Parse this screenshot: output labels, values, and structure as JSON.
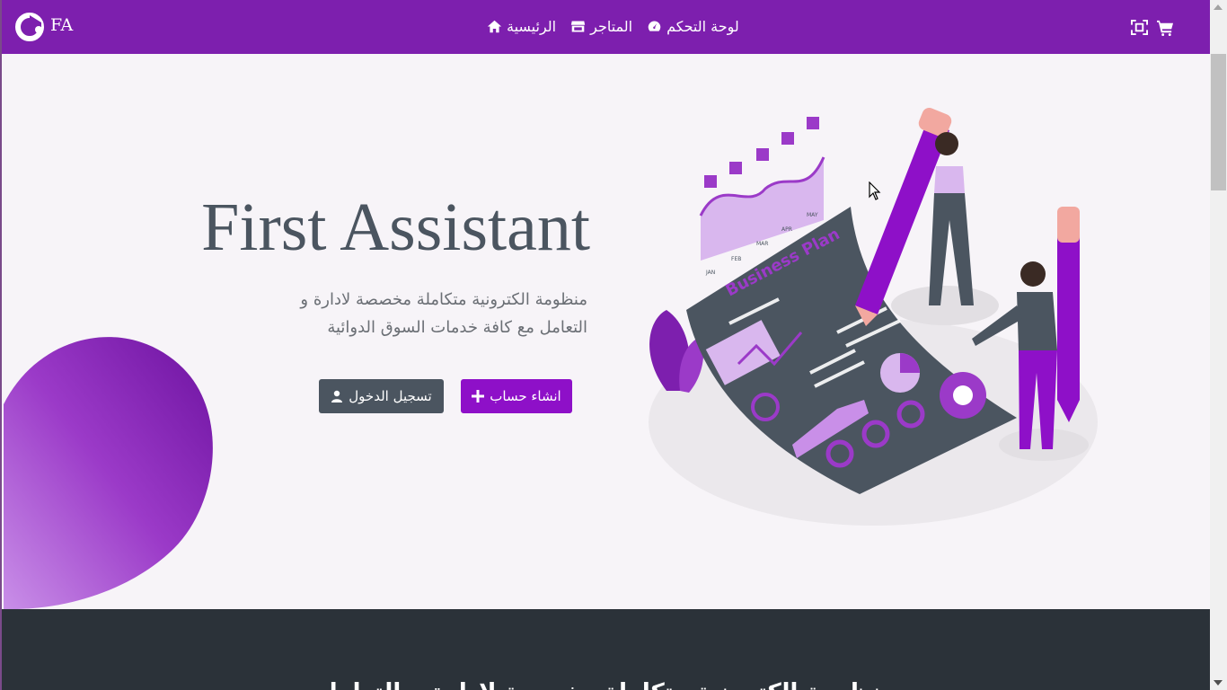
{
  "brand": {
    "logo": "fa-logo-icon",
    "name": "FA"
  },
  "nav": {
    "dashboard": "لوحة التحكم",
    "stores": "المتاجر",
    "home": "الرئيسية"
  },
  "icons": {
    "dashboard": "tachometer-icon",
    "stores": "store-icon",
    "home": "home-icon",
    "cart": "shopping-cart-icon",
    "qr": "qr-scan-icon"
  },
  "hero": {
    "title": "First Assistant",
    "description": "منظومة الكترونية متكاملة مخصصة لادارة و التعامل مع كافة خدمات السوق الدوائية",
    "illustration_label": "Business Plan",
    "chart_months": [
      "JAN",
      "FEB",
      "MAR",
      "APR",
      "MAY"
    ]
  },
  "buttons": {
    "signup": "انشاء حساب",
    "login": "تسجيل الدخول"
  },
  "footer": {
    "partial_heading": "منظومة الكترونية متكاملة مخصصة لادارة و التعامل"
  },
  "colors": {
    "navbar": "#7d1fae",
    "primary": "#8e10c8",
    "dark": "#4b5560",
    "footer": "#2b3239",
    "background": "#f7f4f8"
  }
}
